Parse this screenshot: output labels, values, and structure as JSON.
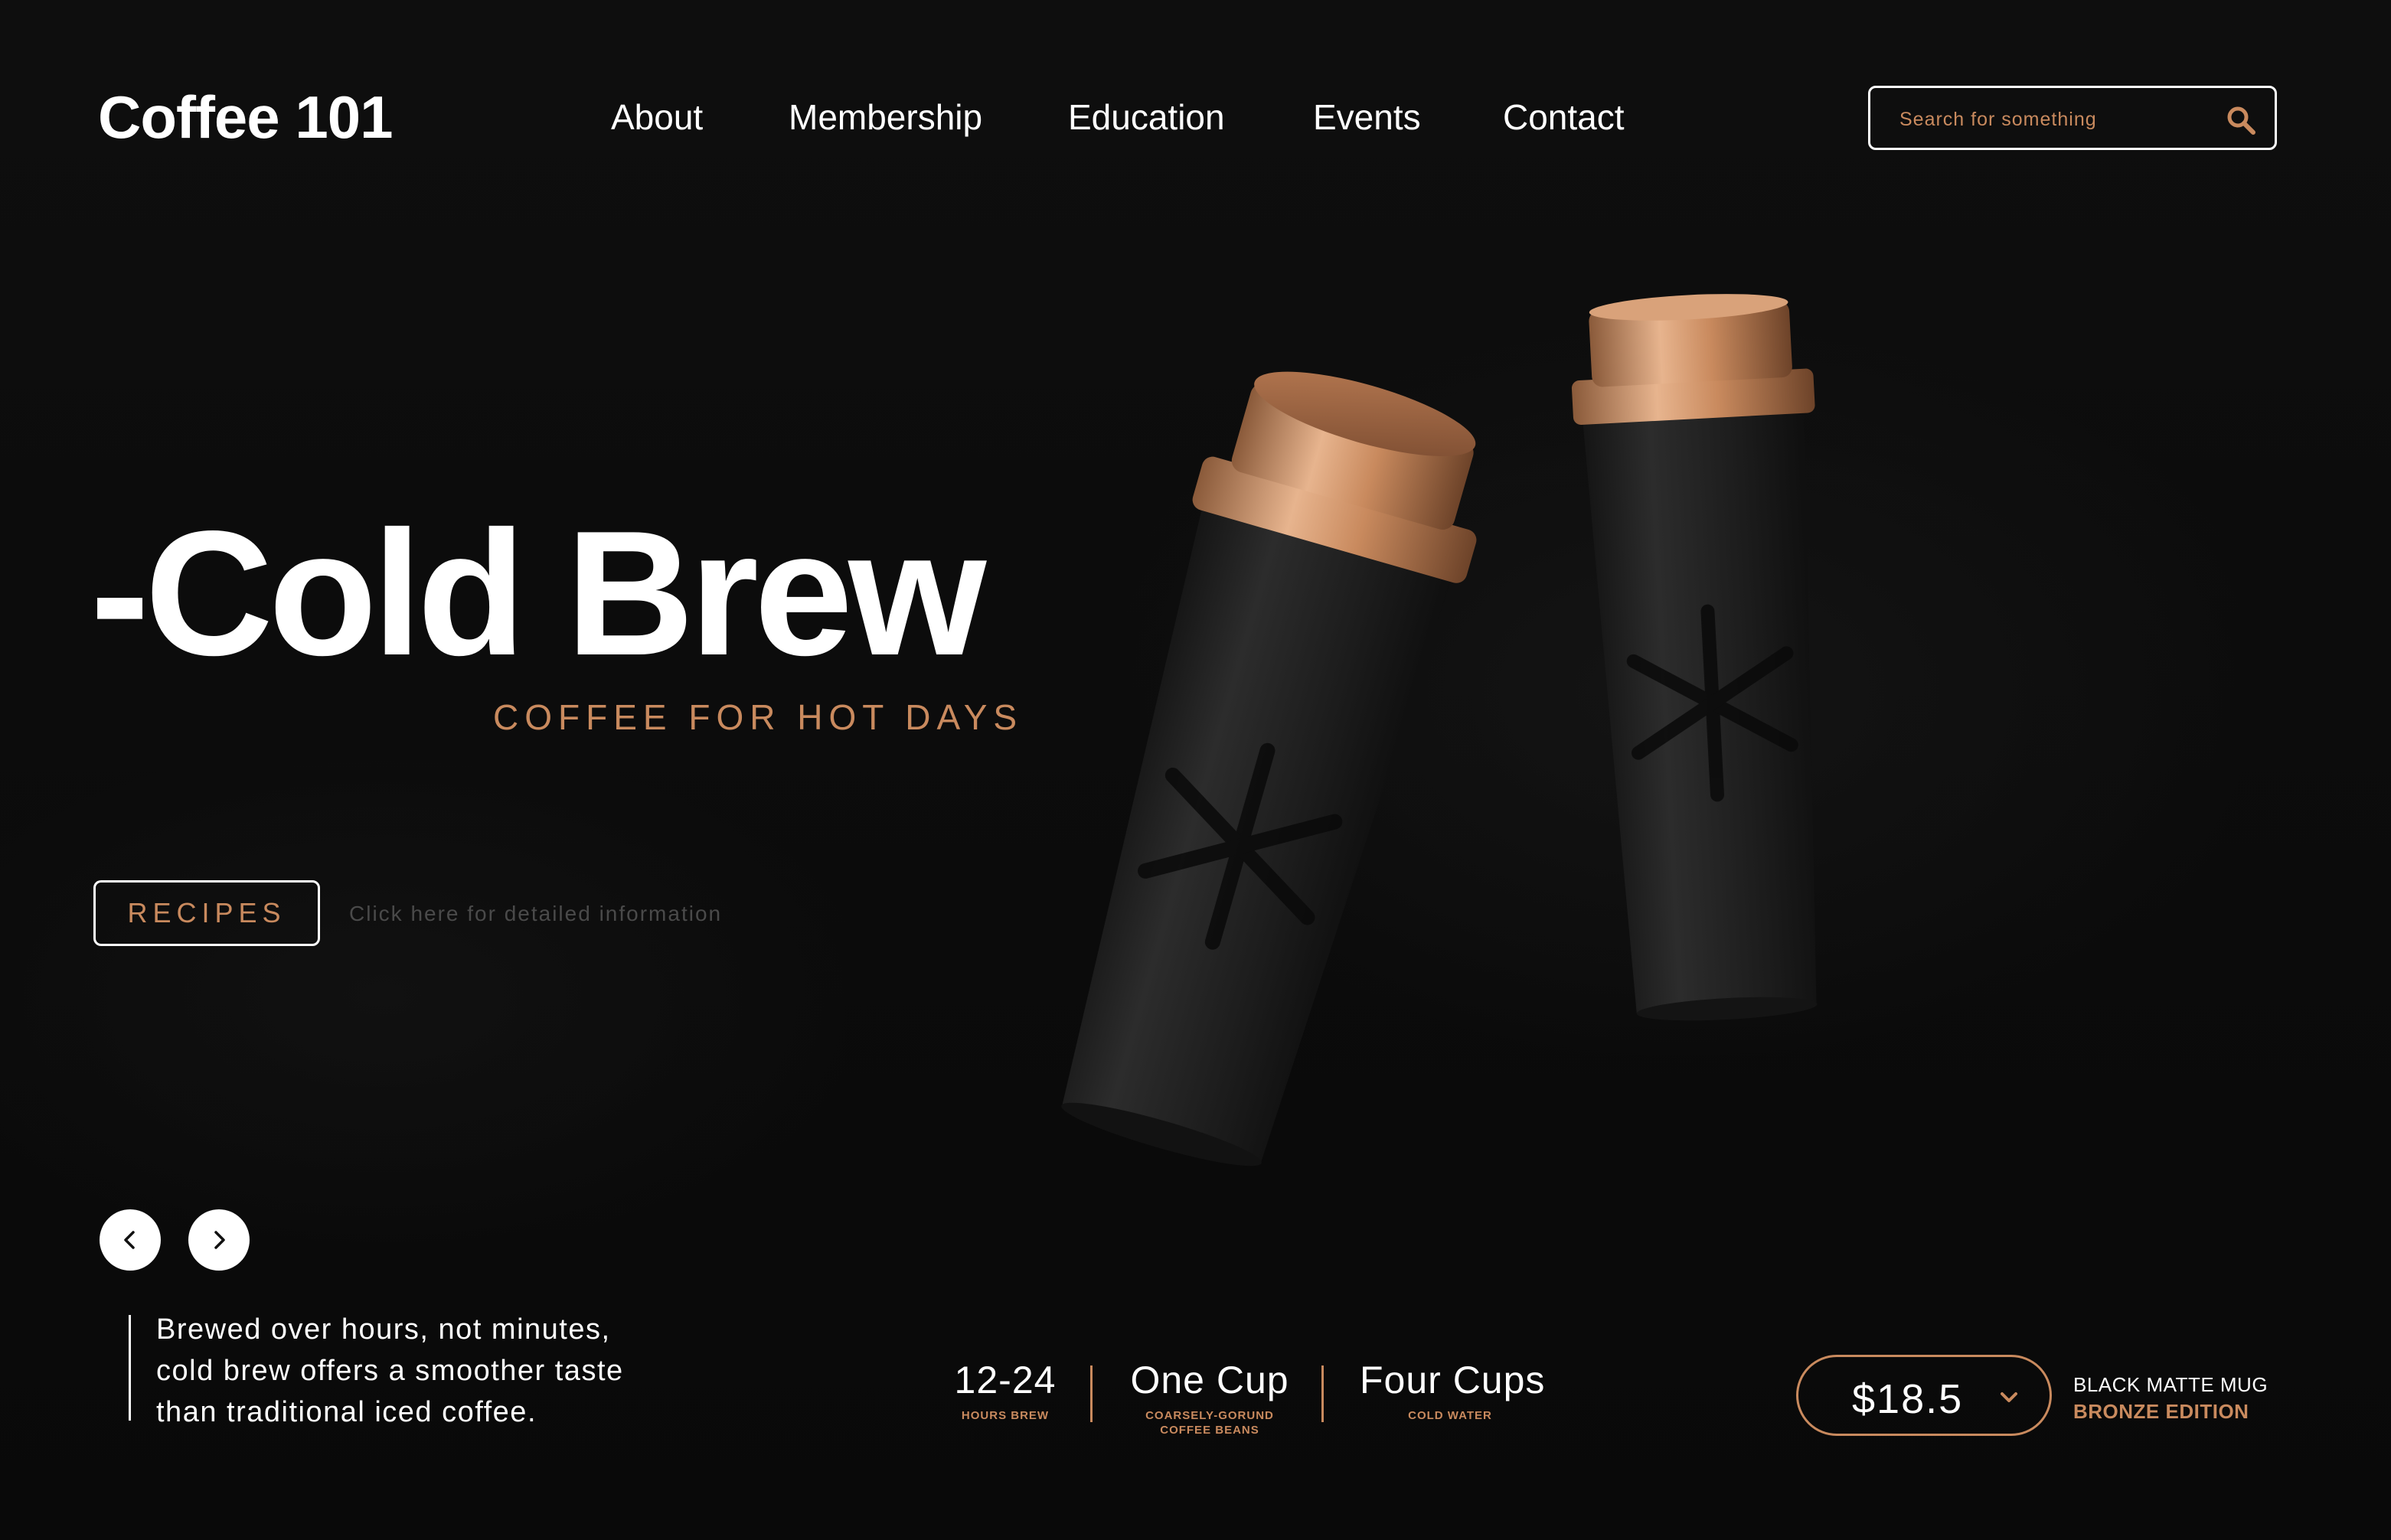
{
  "header": {
    "logo": "Coffee 101",
    "nav": [
      "About",
      "Membership",
      "Education",
      "Events",
      "Contact"
    ],
    "search": {
      "placeholder": "Search for something",
      "value": ""
    }
  },
  "hero": {
    "title": "-Cold Brew",
    "subtitle": "COFFEE FOR HOT DAYS",
    "recipes_button": "RECIPES",
    "recipes_hint": "Click here for detailed information"
  },
  "description": {
    "lines": [
      "Brewed over hours, not minutes,",
      "cold brew offers a smoother taste",
      "than  traditional iced coffee."
    ]
  },
  "stats": [
    {
      "value": "12-24",
      "label_lines": [
        "HOURS BREW"
      ]
    },
    {
      "value": "One Cup",
      "label_lines": [
        "COARSELY-GORUND",
        "COFFEE BEANS"
      ]
    },
    {
      "value": "Four Cups",
      "label_lines": [
        "COLD WATER"
      ]
    }
  ],
  "product": {
    "price": "$18.5",
    "name": "BLACK MATTE MUG",
    "edition": "BRONZE EDITION"
  },
  "colors": {
    "accent": "#c98a5e",
    "background": "#0c0c0c",
    "text": "#ffffff"
  },
  "icons": [
    "search-icon",
    "chevron-left-icon",
    "chevron-right-icon",
    "chevron-down-icon",
    "snowflake-icon"
  ]
}
